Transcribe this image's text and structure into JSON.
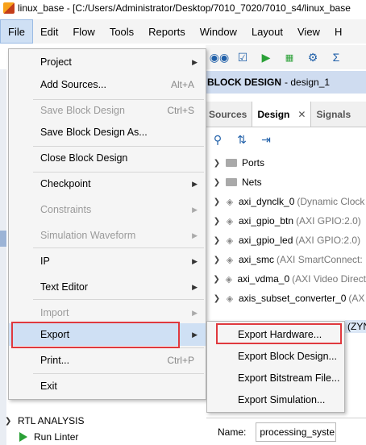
{
  "window": {
    "title": "linux_base - [C:/Users/Administrator/Desktop/7010_7020/7010_s4/linux_base"
  },
  "menubar": [
    "File",
    "Edit",
    "Flow",
    "Tools",
    "Reports",
    "Window",
    "Layout",
    "View",
    "H"
  ],
  "toolbar_icons": [
    "binoculars-icon",
    "checkbox-icon",
    "run-icon",
    "bitstream-icon",
    "gear-icon",
    "sigma-icon"
  ],
  "block_design": {
    "title": "BLOCK DESIGN",
    "name": "- design_1"
  },
  "tabs": {
    "sources": "Sources",
    "design": "Design",
    "close": "✕",
    "signals": "Signals"
  },
  "tree": [
    {
      "label": "Ports",
      "detail": "",
      "kind": "folder"
    },
    {
      "label": "Nets",
      "detail": "",
      "kind": "folder"
    },
    {
      "label": "axi_dynclk_0",
      "detail": "(Dynamic Clock",
      "kind": "ip"
    },
    {
      "label": "axi_gpio_btn",
      "detail": "(AXI GPIO:2.0)",
      "kind": "ip"
    },
    {
      "label": "axi_gpio_led",
      "detail": "(AXI GPIO:2.0)",
      "kind": "ip"
    },
    {
      "label": "axi_smc",
      "detail": "(AXI SmartConnect:",
      "kind": "ip"
    },
    {
      "label": "axi_vdma_0",
      "detail": "(AXI Video Direct",
      "kind": "ip"
    },
    {
      "label": "axis_subset_converter_0",
      "detail": "(AX",
      "kind": "ip"
    }
  ],
  "tree_partial": "(ZYN",
  "file_menu": {
    "project": "Project",
    "add_sources": "Add Sources...",
    "add_sources_sc": "Alt+A",
    "save_bd": "Save Block Design",
    "save_bd_sc": "Ctrl+S",
    "save_bd_as": "Save Block Design As...",
    "close_bd": "Close Block Design",
    "checkpoint": "Checkpoint",
    "constraints": "Constraints",
    "sim_waveform": "Simulation Waveform",
    "ip": "IP",
    "text_editor": "Text Editor",
    "import": "Import",
    "export": "Export",
    "print": "Print...",
    "print_sc": "Ctrl+P",
    "exit": "Exit"
  },
  "export_submenu": {
    "hardware": "Export Hardware...",
    "block_design": "Export Block Design...",
    "bitstream": "Export Bitstream File...",
    "simulation": "Export Simulation..."
  },
  "rtl": {
    "heading": "RTL ANALYSIS",
    "run_linter": "Run Linter"
  },
  "properties": {
    "name_label": "Name:",
    "name_value": "processing_syste"
  },
  "colors": {
    "highlight": "#cfe0f4",
    "annotation": "#e0393e",
    "run_green": "#2aa036"
  }
}
